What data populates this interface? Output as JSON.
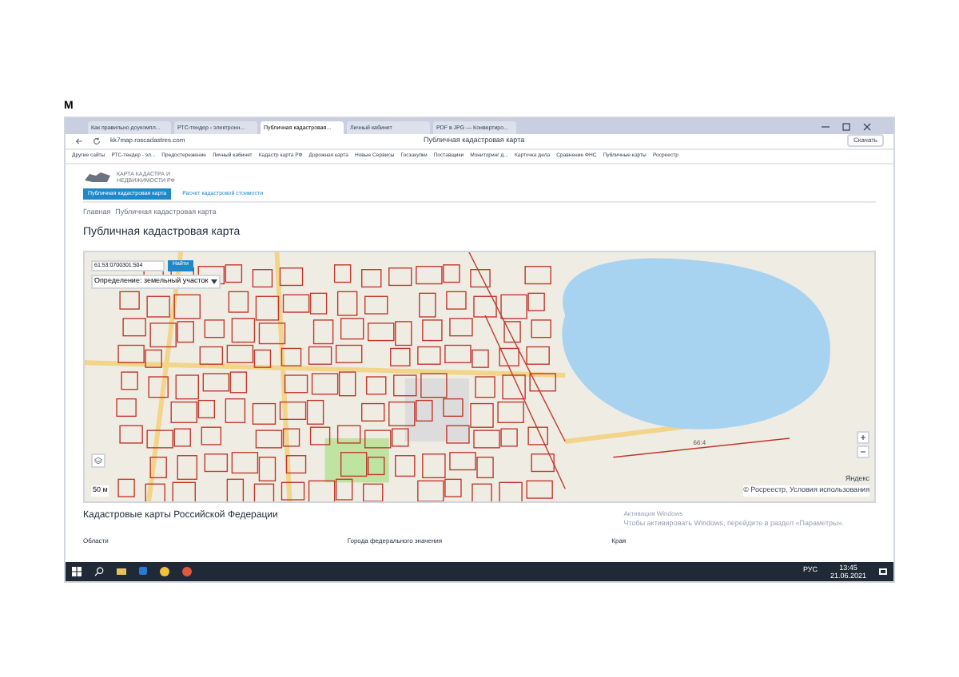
{
  "page_mark": "М",
  "tabs": [
    {
      "label": "Как правильно доукомпл...",
      "selected": false
    },
    {
      "label": "РТС-тендер - электронн...",
      "selected": false
    },
    {
      "label": "Публичная кадастровая...",
      "selected": true
    },
    {
      "label": "Личный кабинет",
      "selected": false
    },
    {
      "label": "PDF в JPG — Конвертиро...",
      "selected": false
    }
  ],
  "address": {
    "url": "kk7map.roscadastres.com",
    "page_title": "Публичная кадастровая карта",
    "download": "Скачать"
  },
  "bookmarks": [
    "Другие сайты",
    "РТС-тендер - эл...",
    "Предостережение",
    "Личный кабинет",
    "Кадастр карта РФ",
    "Дорожная карта",
    "Новые Сервисы",
    "Госзакупки",
    "Поставщики",
    "Мониторинг д...",
    "Карточка дела",
    "Сравнение ФНС",
    "Публичные карты",
    "Росреестр"
  ],
  "site": {
    "logo_lines": [
      "КАРТА КАДАСТРА И",
      "НЕДВИЖИМОСТИ РФ"
    ],
    "nav": [
      {
        "label": "Публичная кадастровая карта",
        "selected": true
      },
      {
        "label": "Расчет кадастровой стоимости",
        "selected": false
      }
    ],
    "breadcrumbs": [
      "Главная",
      "Публичная кадастровая карта"
    ],
    "title": "Публичная кадастровая карта"
  },
  "map": {
    "search_value": "61:53:0700301:504",
    "search_button": "Найти",
    "type_select": "Определение: земельный участок",
    "scale": "50 м",
    "provider": "Яндекс",
    "copyright": "© Росреестр, Условия использования",
    "plot_label": "66:4"
  },
  "regions": {
    "title": "Кадастровые карты Российской Федерации",
    "columns": [
      "Области",
      "Города федерального значения",
      "Края"
    ]
  },
  "activation": {
    "title": "Активация Windows",
    "hint": "Чтобы активировать Windows, перейдите в раздел «Параметры»."
  },
  "taskbar": {
    "language": "РУС",
    "time": "13:45",
    "date": "21.06.2021"
  }
}
